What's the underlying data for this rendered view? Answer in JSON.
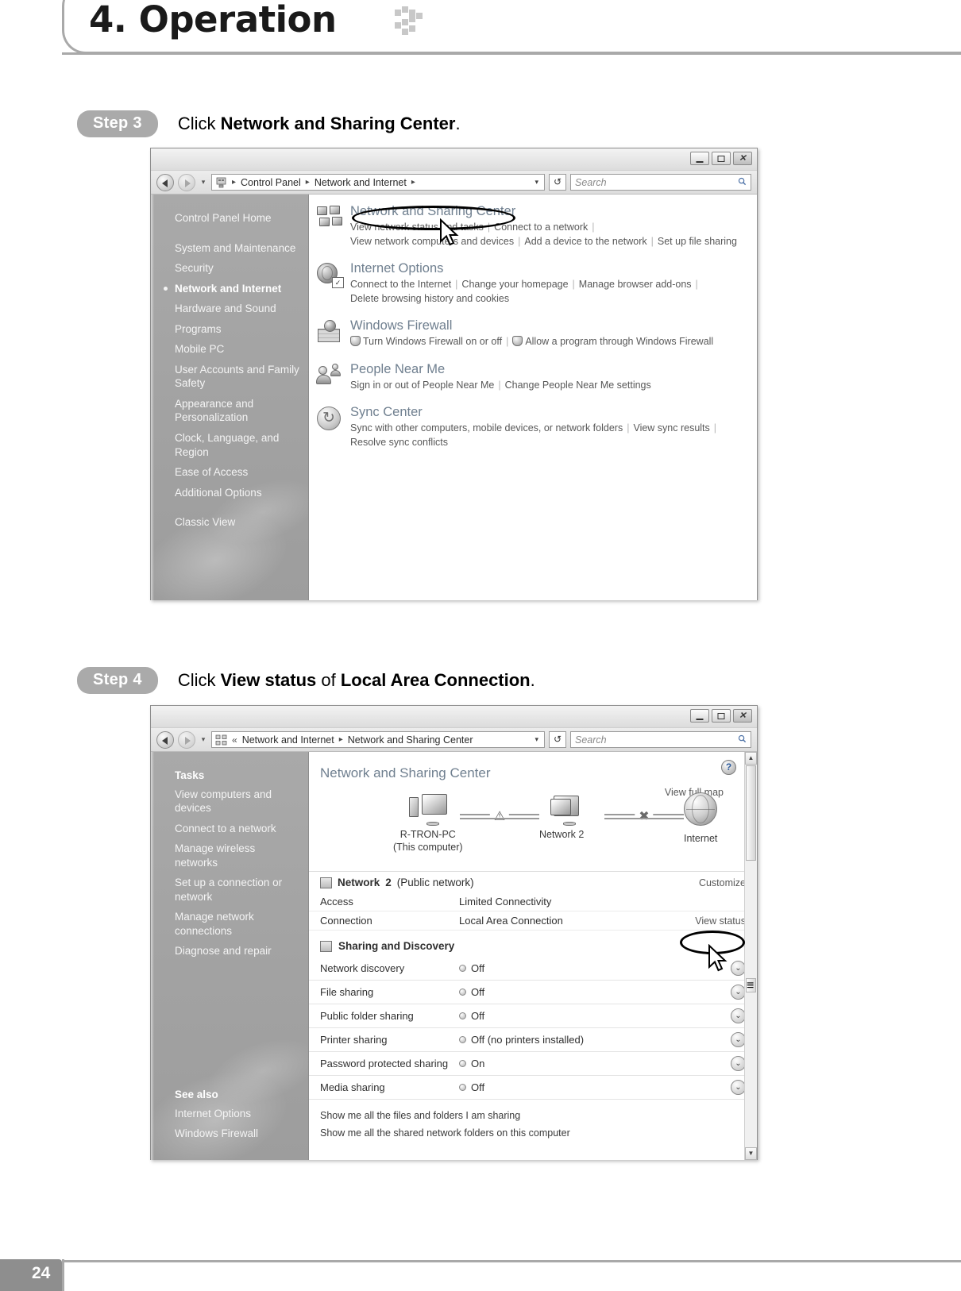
{
  "page": {
    "title": "4. Operation",
    "number": "24"
  },
  "steps": [
    {
      "badge": "Step 3",
      "text_prefix": "Click ",
      "text_bold": "Network and Sharing Center",
      "text_suffix": "."
    },
    {
      "badge": "Step 4",
      "text_prefix": "Click ",
      "text_bold": "View status",
      "text_mid": " of ",
      "text_bold2": "Local Area Connection",
      "text_suffix": "."
    }
  ],
  "window1": {
    "address": {
      "crumb1": "Control Panel",
      "crumb2": "Network and Internet",
      "sep": "▸",
      "dropdown": "▾",
      "refresh": "↺",
      "search_placeholder": "Search",
      "search_icon": "🔍"
    },
    "controls": {
      "minimize": "minimize-icon",
      "maximize": "maximize-icon",
      "close": "✕"
    },
    "sidebar": [
      {
        "label": "Control Panel Home",
        "style": "plain",
        "gap": false
      },
      {
        "label": "System and Maintenance",
        "style": "plain",
        "gap": true
      },
      {
        "label": "Security",
        "style": "plain",
        "gap": false
      },
      {
        "label": "Network and Internet",
        "style": "bold-bullet",
        "gap": false
      },
      {
        "label": "Hardware and Sound",
        "style": "plain",
        "gap": false
      },
      {
        "label": "Programs",
        "style": "plain",
        "gap": false
      },
      {
        "label": "Mobile PC",
        "style": "plain",
        "gap": false
      },
      {
        "label": "User Accounts and Family Safety",
        "style": "plain",
        "gap": false
      },
      {
        "label": "Appearance and Personalization",
        "style": "plain",
        "gap": false
      },
      {
        "label": "Clock, Language, and Region",
        "style": "plain",
        "gap": false
      },
      {
        "label": "Ease of Access",
        "style": "plain",
        "gap": false
      },
      {
        "label": "Additional Options",
        "style": "plain",
        "gap": false
      },
      {
        "label": "Classic View",
        "style": "plain",
        "gap": true
      }
    ],
    "categories": [
      {
        "icon": "network-computers-icon",
        "title": "Network and Sharing Center",
        "line1": [
          "View network status and tasks",
          "Connect to a network"
        ],
        "line1_trailing_bar": true,
        "line2": [
          "View network computers and devices",
          "Add a device to the network",
          "Set up file sharing"
        ]
      },
      {
        "icon": "internet-options-icon",
        "title": "Internet Options",
        "line1": [
          "Connect to the Internet",
          "Change your homepage",
          "Manage browser add-ons"
        ],
        "line1_trailing_bar": true,
        "line2": [
          "Delete browsing history and cookies"
        ]
      },
      {
        "icon": "windows-firewall-icon",
        "title": "Windows Firewall",
        "line1_shielded": [
          "Turn Windows Firewall on or off",
          "Allow a program through Windows Firewall"
        ]
      },
      {
        "icon": "people-near-me-icon",
        "title": "People Near Me",
        "line1": [
          "Sign in or out of People Near Me",
          "Change People Near Me settings"
        ]
      },
      {
        "icon": "sync-center-icon",
        "title": "Sync Center",
        "line1": [
          "Sync with other computers, mobile devices, or network folders",
          "View sync results"
        ],
        "line1_trailing_bar": true,
        "line2": [
          "Resolve sync conflicts"
        ]
      }
    ]
  },
  "window2": {
    "address": {
      "chevrons": "«",
      "crumb1": "Network and Internet",
      "crumb2": "Network and Sharing Center",
      "sep": "▸",
      "dropdown": "▾",
      "refresh": "↺",
      "search_placeholder": "Search",
      "search_icon": "🔍"
    },
    "sidebar": {
      "tasks_head": "Tasks",
      "tasks": [
        "View computers and devices",
        "Connect to a network",
        "Manage wireless networks",
        "Set up a connection or network",
        "Manage network connections",
        "Diagnose and repair"
      ],
      "see_also_head": "See also",
      "see_also": [
        "Internet Options",
        "Windows Firewall"
      ]
    },
    "page_title": "Network and Sharing Center",
    "help_glyph": "?",
    "view_full_map": "View full map",
    "map": {
      "node1_line1": "R-TRON-PC",
      "node1_line2": "(This computer)",
      "node2": "Network  2",
      "node3": "Internet",
      "link1_badge": "⚠",
      "link2_badge": "✖"
    },
    "network_section": {
      "name": "Network",
      "number": "2",
      "type": "(Public network)",
      "customize": "Customize",
      "rows": [
        {
          "key": "Access",
          "value": "Limited Connectivity",
          "action": ""
        },
        {
          "key": "Connection",
          "value": "Local Area Connection",
          "action": "View status"
        }
      ]
    },
    "sharing_section": {
      "head": "Sharing and Discovery",
      "rows": [
        {
          "key": "Network discovery",
          "value": "Off"
        },
        {
          "key": "File sharing",
          "value": "Off"
        },
        {
          "key": "Public folder sharing",
          "value": "Off"
        },
        {
          "key": "Printer sharing",
          "value": "Off (no printers installed)"
        },
        {
          "key": "Password protected sharing",
          "value": "On"
        },
        {
          "key": "Media sharing",
          "value": "Off"
        }
      ],
      "chevron": "⌄"
    },
    "footer_links": [
      "Show me all the files and folders I am sharing",
      "Show me all the shared network folders on this computer"
    ]
  }
}
